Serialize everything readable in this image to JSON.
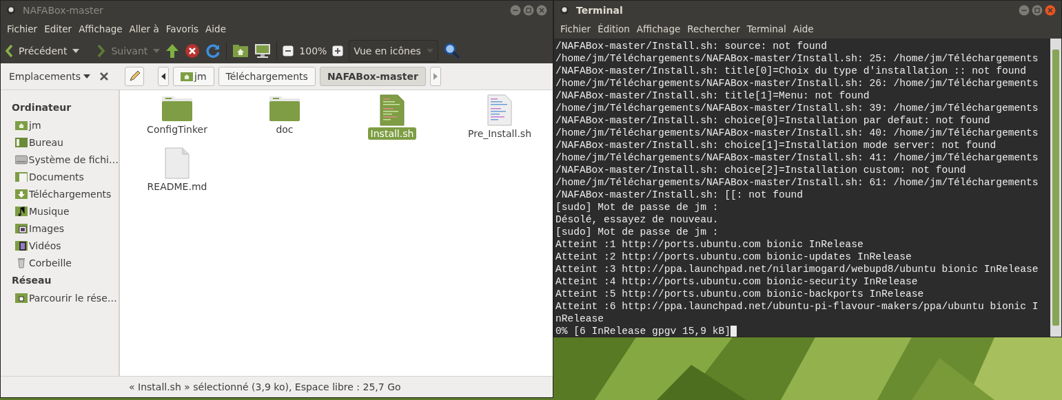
{
  "file_manager": {
    "title": "NAFABox-master",
    "menu": [
      "Fichier",
      "Editer",
      "Affichage",
      "Aller à",
      "Favoris",
      "Aide"
    ],
    "toolbar": {
      "back": {
        "label": "Précédent",
        "disabled": false
      },
      "forward": {
        "label": "Suivant",
        "disabled": true
      },
      "zoom": "100%",
      "view": "Vue en icônes"
    },
    "places_label": "Emplacements",
    "breadcrumbs": [
      {
        "label": "jm",
        "selected": false
      },
      {
        "label": "Téléchargements",
        "selected": false
      },
      {
        "label": "NAFABox-master",
        "selected": true
      }
    ],
    "sidebar": [
      {
        "heading": "Ordinateur",
        "items": [
          {
            "label": "jm"
          },
          {
            "label": "Bureau"
          },
          {
            "label": "Système de fichi…"
          },
          {
            "label": "Documents"
          },
          {
            "label": "Téléchargements"
          },
          {
            "label": "Musique"
          },
          {
            "label": "Images"
          },
          {
            "label": "Vidéos"
          },
          {
            "label": "Corbeille"
          }
        ]
      },
      {
        "heading": "Réseau",
        "items": [
          {
            "label": "Parcourir le rése…"
          }
        ]
      }
    ],
    "files": [
      {
        "name": "ConfigTinker",
        "kind": "folder",
        "selected": false
      },
      {
        "name": "doc",
        "kind": "folder",
        "selected": false
      },
      {
        "name": "Install.sh",
        "kind": "script",
        "selected": true
      },
      {
        "name": "Pre_Install.sh",
        "kind": "text",
        "selected": false
      },
      {
        "name": "README.md",
        "kind": "blank",
        "selected": false
      }
    ],
    "status_bar": "« Install.sh » sélectionné (3,9 ko), Espace libre : 25,7 Go"
  },
  "terminal": {
    "title": "Terminal",
    "menu": [
      "Fichier",
      "Édition",
      "Affichage",
      "Rechercher",
      "Terminal",
      "Aide"
    ],
    "lines": [
      "/NAFABox-master/Install.sh: source: not found",
      "/home/jm/Téléchargements/NAFABox-master/Install.sh: 25: /home/jm/Téléchargements",
      "/NAFABox-master/Install.sh: title[0]=Choix du type d'installation :: not found",
      "/home/jm/Téléchargements/NAFABox-master/Install.sh: 26: /home/jm/Téléchargements",
      "/NAFABox-master/Install.sh: title[1]=Menu: not found",
      "/home/jm/Téléchargements/NAFABox-master/Install.sh: 39: /home/jm/Téléchargements",
      "/NAFABox-master/Install.sh: choice[0]=Installation par defaut: not found",
      "/home/jm/Téléchargements/NAFABox-master/Install.sh: 40: /home/jm/Téléchargements",
      "/NAFABox-master/Install.sh: choice[1]=Installation mode server: not found",
      "/home/jm/Téléchargements/NAFABox-master/Install.sh: 41: /home/jm/Téléchargements",
      "/NAFABox-master/Install.sh: choice[2]=Installation custom: not found",
      "/home/jm/Téléchargements/NAFABox-master/Install.sh: 61: /home/jm/Téléchargements",
      "/NAFABox-master/Install.sh: [[: not found",
      "[sudo] Mot de passe de jm :",
      "Désolé, essayez de nouveau.",
      "[sudo] Mot de passe de jm :",
      "Atteint :1 http://ports.ubuntu.com bionic InRelease",
      "Atteint :2 http://ports.ubuntu.com bionic-updates InRelease",
      "Atteint :3 http://ppa.launchpad.net/nilarimogard/webupd8/ubuntu bionic InRelease",
      "Atteint :4 http://ports.ubuntu.com bionic-security InRelease",
      "Atteint :5 http://ports.ubuntu.com bionic-backports InRelease",
      "Atteint :6 http://ppa.launchpad.net/ubuntu-pi-flavour-makers/ppa/ubuntu bionic I",
      "nRelease",
      "0% [6 InRelease gpgv 15,9 kB]"
    ],
    "cursor": true
  }
}
